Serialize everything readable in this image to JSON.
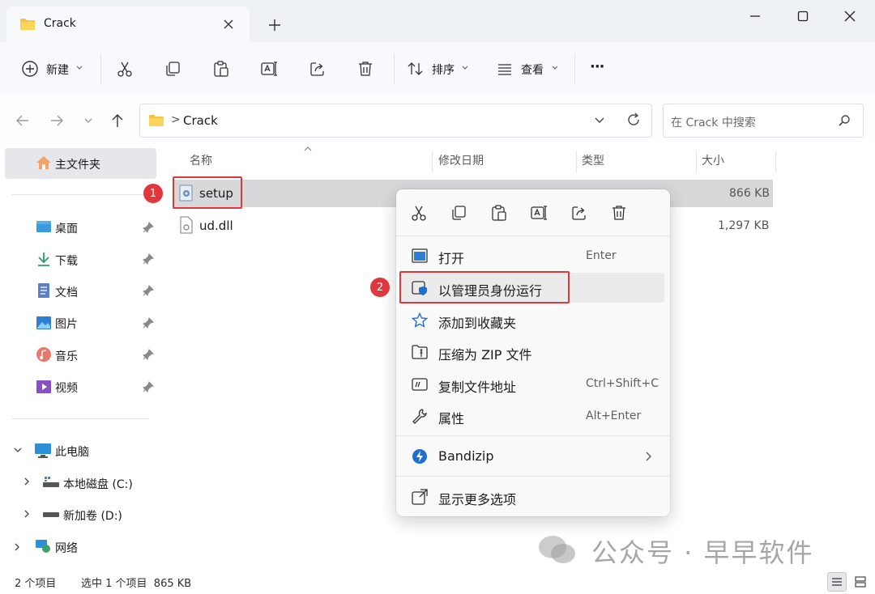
{
  "window": {
    "tab_title": "Crack"
  },
  "toolbar": {
    "new_label": "新建",
    "sort_label": "排序",
    "view_label": "查看",
    "more_label": "···"
  },
  "address": {
    "folder": "Crack",
    "chevron": ">",
    "search_placeholder": "在 Crack 中搜索"
  },
  "sidebar": {
    "home": "主文件夹",
    "quick": [
      {
        "label": "桌面"
      },
      {
        "label": "下载"
      },
      {
        "label": "文档"
      },
      {
        "label": "图片"
      },
      {
        "label": "音乐"
      },
      {
        "label": "视频"
      }
    ],
    "this_pc": "此电脑",
    "drives": [
      {
        "label": "本地磁盘 (C:)"
      },
      {
        "label": "新加卷 (D:)"
      }
    ],
    "network": "网络"
  },
  "columns": {
    "name": "名称",
    "modified": "修改日期",
    "type": "类型",
    "size": "大小"
  },
  "files": [
    {
      "name": "setup",
      "size": "866 KB"
    },
    {
      "name": "ud.dll",
      "size": "1,297 KB"
    }
  ],
  "context_menu": {
    "items": [
      {
        "label": "打开",
        "shortcut": "Enter"
      },
      {
        "label": "以管理员身份运行",
        "shortcut": ""
      },
      {
        "label": "添加到收藏夹",
        "shortcut": ""
      },
      {
        "label": "压缩为 ZIP 文件",
        "shortcut": ""
      },
      {
        "label": "复制文件地址",
        "shortcut": "Ctrl+Shift+C"
      },
      {
        "label": "属性",
        "shortcut": "Alt+Enter"
      },
      {
        "label": "Bandizip",
        "shortcut": ""
      },
      {
        "label": "显示更多选项",
        "shortcut": ""
      }
    ]
  },
  "annotations": {
    "badge1": "1",
    "badge2": "2"
  },
  "status": {
    "count": "2 个项目",
    "selection": "选中 1 个项目  865 KB"
  },
  "watermark": "公众号 · 早早软件",
  "colors": {
    "accent": "#0067c0",
    "highlight": "#e0373d",
    "folder": "#f5c342"
  }
}
